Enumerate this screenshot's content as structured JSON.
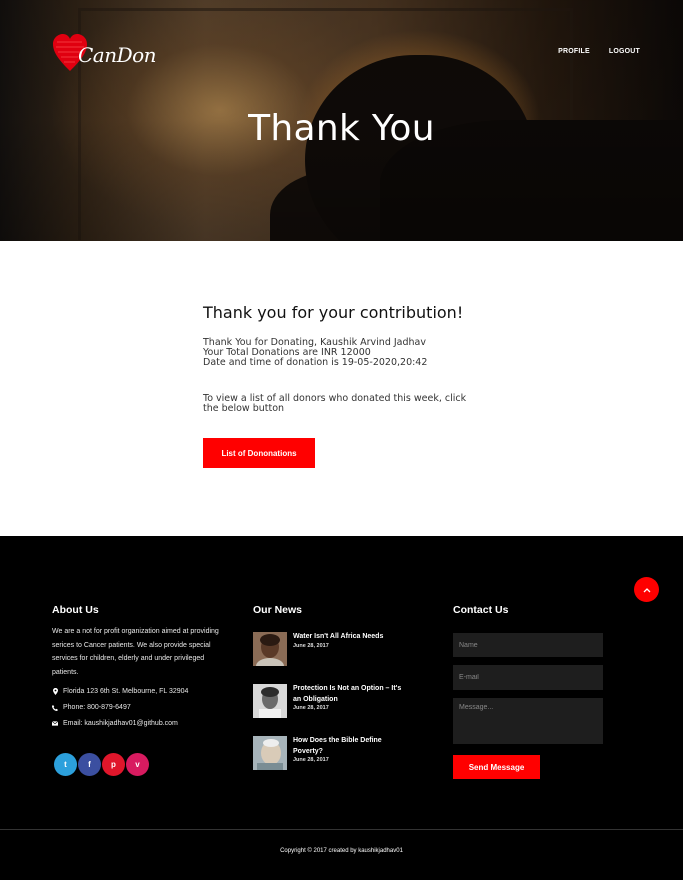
{
  "header": {
    "brand": "CanDon",
    "nav": [
      "PROFILE",
      "LOGOUT"
    ],
    "hero_title": "Thank You"
  },
  "main": {
    "heading": "Thank you for your contribution!",
    "lines": [
      "Thank You for Donating, Kaushik Arvind Jadhav",
      "Your Total Donations are INR 12000",
      "Date and time of donation is 19-05-2020,20:42"
    ],
    "cta_text": "To view a list of all donors who donated this week, click the below button",
    "button_label": "List of Dononations"
  },
  "footer": {
    "about": {
      "title": "About Us",
      "text": "We are a not for profit organization aimed at providing serices to Cancer patients. We also provide special services for children, elderly and under privileged patients.",
      "address": "Florida 123 6th St. Melbourne, FL 32904",
      "phone": "Phone: 800-879-6497",
      "email": "Email: kaushikjadhav01@github.com",
      "socials": [
        {
          "icon": "tumblr-icon",
          "glyph": "t",
          "color": "#2ca0dc"
        },
        {
          "icon": "facebook-icon",
          "glyph": "f",
          "color": "#3b4fa0"
        },
        {
          "icon": "pinterest-icon",
          "glyph": "p",
          "color": "#e0162b"
        },
        {
          "icon": "vimeo-icon",
          "glyph": "v",
          "color": "#d81b60"
        }
      ]
    },
    "news": {
      "title": "Our News",
      "items": [
        {
          "title": "Water Isn't All Africa Needs",
          "date": "June 28, 2017"
        },
        {
          "title": "Protection Is Not an Option – It's an Obligation",
          "date": "June 28, 2017"
        },
        {
          "title": "How Does the Bible Define Poverty?",
          "date": "June 28, 2017"
        }
      ]
    },
    "contact": {
      "title": "Contact Us",
      "name_placeholder": "Name",
      "email_placeholder": "E-mail",
      "message_placeholder": "Message...",
      "send_label": "Send Message"
    },
    "copyright": "Copyright © 2017 created by kaushikjadhav01"
  },
  "colors": {
    "accent": "#ff0000",
    "footer_bg": "#000000"
  }
}
